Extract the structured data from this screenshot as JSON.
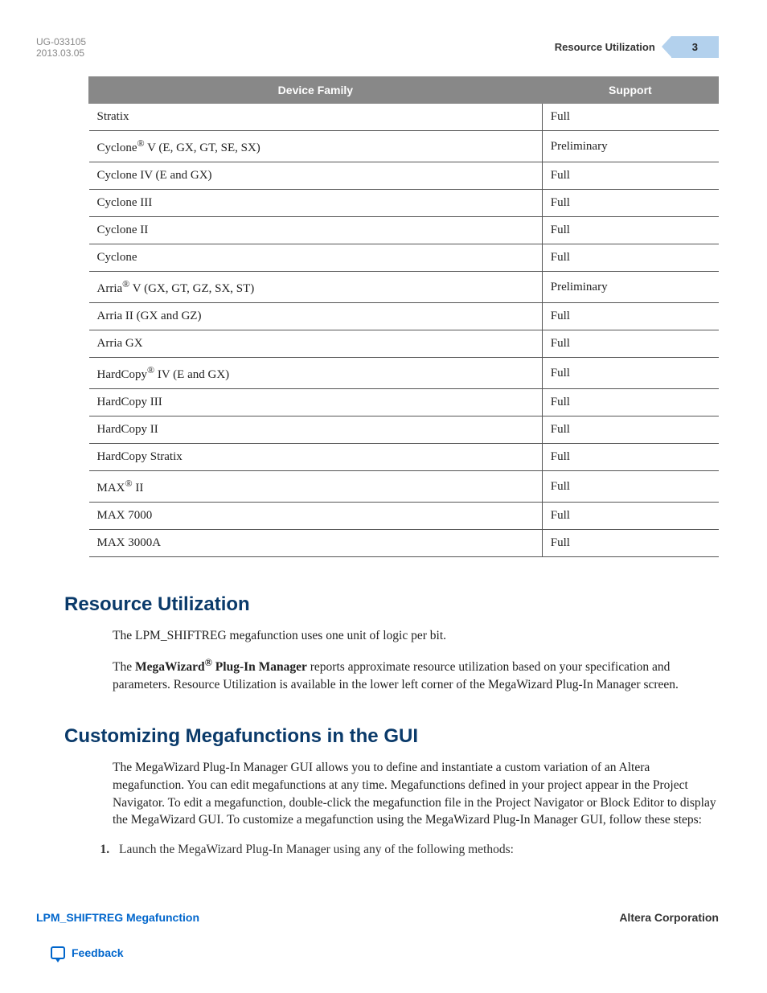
{
  "header": {
    "doc_id": "UG-033105",
    "date": "2013.03.05",
    "section_title": "Resource Utilization",
    "page_number": "3"
  },
  "table": {
    "col1": "Device Family",
    "col2": "Support",
    "rows": [
      {
        "family": "Stratix",
        "support": "Full",
        "reg": ""
      },
      {
        "family_pre": "Cyclone",
        "reg": "®",
        "family_post": " V (E, GX, GT, SE, SX)",
        "support": "Preliminary"
      },
      {
        "family": "Cyclone IV (E and GX)",
        "support": "Full",
        "reg": ""
      },
      {
        "family": "Cyclone III",
        "support": "Full",
        "reg": ""
      },
      {
        "family": "Cyclone II",
        "support": "Full",
        "reg": ""
      },
      {
        "family": "Cyclone",
        "support": "Full",
        "reg": ""
      },
      {
        "family_pre": "Arria",
        "reg": "®",
        "family_post": " V (GX, GT, GZ, SX, ST)",
        "support": "Preliminary"
      },
      {
        "family": "Arria II (GX and GZ)",
        "support": "Full",
        "reg": ""
      },
      {
        "family": "Arria GX",
        "support": "Full",
        "reg": ""
      },
      {
        "family_pre": "HardCopy",
        "reg": "®",
        "family_post": " IV (E and GX)",
        "support": "Full"
      },
      {
        "family": "HardCopy III",
        "support": "Full",
        "reg": ""
      },
      {
        "family": "HardCopy II",
        "support": "Full",
        "reg": ""
      },
      {
        "family": "HardCopy Stratix",
        "support": "Full",
        "reg": ""
      },
      {
        "family_pre": "MAX",
        "reg": "®",
        "family_post": " II",
        "support": "Full"
      },
      {
        "family": "MAX 7000",
        "support": "Full",
        "reg": ""
      },
      {
        "family": "MAX 3000A",
        "support": "Full",
        "reg": ""
      }
    ]
  },
  "sections": {
    "resource": {
      "heading": "Resource Utilization",
      "p1": "The LPM_SHIFTREG megafunction uses one unit of logic per bit.",
      "p2_pre": "The ",
      "p2_bold_pre": "MegaWizard",
      "p2_reg": "®",
      "p2_bold_post": " Plug-In Manager",
      "p2_post": " reports approximate resource utilization based on your specification and parameters. Resource Utilization is available in the lower left corner of the MegaWizard Plug-In Manager screen."
    },
    "customizing": {
      "heading": "Customizing Megafunctions in the GUI",
      "p1": "The MegaWizard Plug-In Manager GUI allows you to define and instantiate a custom variation of an Altera megafunction. You can edit megafunctions at any time. Megafunctions defined in your project appear in the Project Navigator. To edit a megafunction, double-click the megafunction file in the Project Navigator or Block Editor to display the MegaWizard GUI. To customize a megafunction using the MegaWizard Plug-In Manager GUI, follow these steps:",
      "step1": "Launch the MegaWizard Plug-In Manager using any of the following methods:"
    }
  },
  "footer": {
    "left": "LPM_SHIFTREG Megafunction",
    "right": "Altera Corporation",
    "feedback": "Feedback"
  }
}
